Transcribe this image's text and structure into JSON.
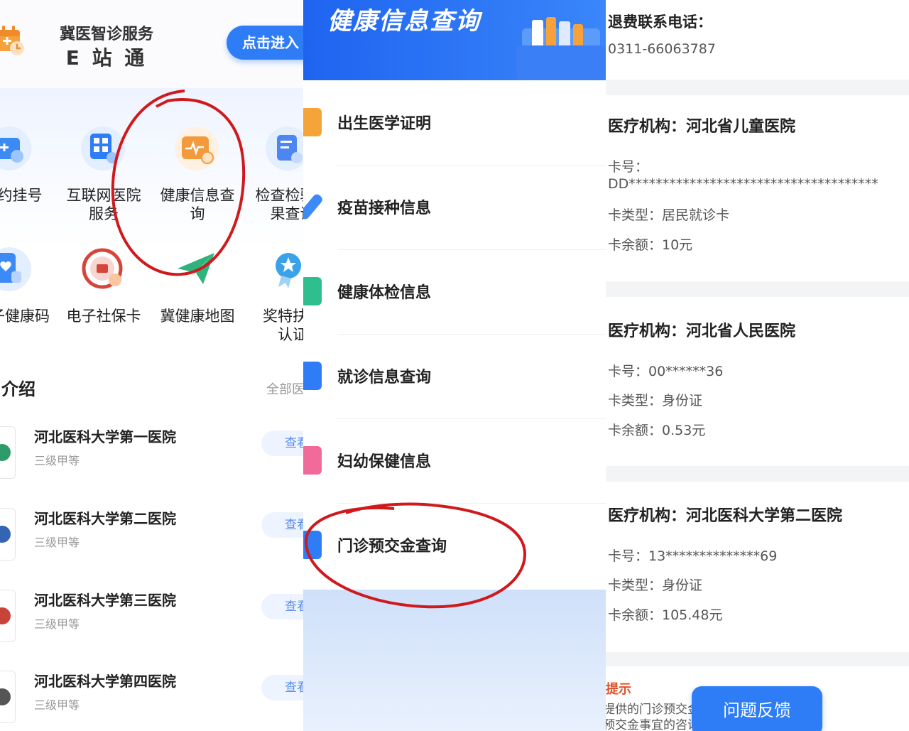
{
  "panel1": {
    "service_title": "冀医智诊服务",
    "service_name": "E 站 通",
    "enter_button": "点击进入",
    "grid": [
      {
        "line1": "约挂号",
        "line2": "",
        "icon": "calendar-plus-icon",
        "color": "#3b8af5"
      },
      {
        "line1": "互联网医院",
        "line2": "服务",
        "icon": "hospital-grid-icon",
        "color": "#2f7df6"
      },
      {
        "line1": "健康信息查",
        "line2": "询",
        "icon": "health-record-search-icon",
        "color": "#f39a3c"
      },
      {
        "line1": "检查检验结",
        "line2": "果查询",
        "icon": "report-check-icon",
        "color": "#4c86f0"
      },
      {
        "line1": "子健康码",
        "line2": "",
        "icon": "health-code-icon",
        "color": "#3b8af5"
      },
      {
        "line1": "电子社保卡",
        "line2": "",
        "icon": "social-security-card-icon",
        "color": "#d4463b"
      },
      {
        "line1": "冀健康地图",
        "line2": "",
        "icon": "paper-plane-map-icon",
        "color": "#2fb37d"
      },
      {
        "line1": "奖特扶助",
        "line2": "认证",
        "icon": "award-medal-icon",
        "color": "#3aa2e8"
      }
    ],
    "section_title": "介绍",
    "view_all": "全部医院",
    "hospitals": [
      {
        "name": "河北医科大学第一医院",
        "grade": "三级甲等",
        "view": "查看"
      },
      {
        "name": "河北医科大学第二医院",
        "grade": "三级甲等",
        "view": "查看"
      },
      {
        "name": "河北医科大学第三医院",
        "grade": "三级甲等",
        "view": "查看"
      },
      {
        "name": "河北医科大学第四医院",
        "grade": "三级甲等",
        "view": "查看"
      }
    ]
  },
  "panel2": {
    "banner_title": "健康信息查询",
    "menu": [
      {
        "label": "出生医学证明",
        "icon": "birth-certificate-icon",
        "color": "#f5a43a"
      },
      {
        "label": "疫苗接种信息",
        "icon": "vaccine-syringe-icon",
        "color": "#3b8af5"
      },
      {
        "label": "健康体检信息",
        "icon": "health-checkup-icon",
        "color": "#2fbf8f"
      },
      {
        "label": "就诊信息查询",
        "icon": "visit-record-icon",
        "color": "#2f7df6"
      },
      {
        "label": "妇幼保健信息",
        "icon": "maternal-child-icon",
        "color": "#f06a9a"
      },
      {
        "label": "门诊预交金查询",
        "icon": "prepaid-wallet-icon",
        "color": "#2f7df6"
      }
    ]
  },
  "panel3": {
    "refund_label": "退费联系电话：",
    "refund_phone": "0311-66063787",
    "cards": [
      {
        "institution": "医疗机构：河北省儿童医院",
        "card_no_label": "卡号：",
        "card_no": "DD*************************************",
        "card_type": "卡类型：居民就诊卡",
        "balance": "卡余额：10元"
      },
      {
        "institution": "医疗机构：河北省人民医院",
        "card_no": "卡号：00******36",
        "card_type": "卡类型：身份证",
        "balance": "卡余额：0.53元"
      },
      {
        "institution": "医疗机构：河北医科大学第二医院",
        "card_no": "卡号：13**************69",
        "card_type": "卡类型：身份证",
        "balance": "卡余额：105.48元"
      }
    ],
    "tip_label": "提示",
    "tip_line1": "提供的门诊预交金数据，仅供参考，",
    "tip_line2": "预交金事宜的咨询及退费办理流",
    "feedback_button": "问题反馈"
  },
  "colors": {
    "accent": "#2f7df6",
    "annotation": "#d0191c",
    "tip": "#e0502a"
  }
}
